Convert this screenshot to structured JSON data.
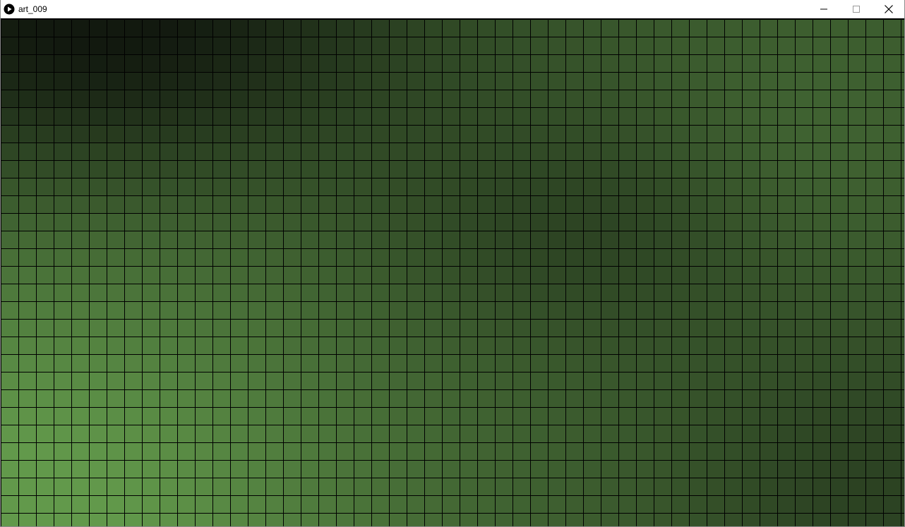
{
  "window": {
    "title": "art_009",
    "app_icon": "play-circle-icon",
    "controls": {
      "minimize_icon": "minimize-icon",
      "maximize_icon": "maximize-icon",
      "close_icon": "close-icon"
    }
  },
  "sketch": {
    "description_colors": {
      "gridline": "#000000",
      "darkest": "#12190f",
      "lightest": "#62994b",
      "mid": "#2e4a25"
    },
    "grid": {
      "columns": 51,
      "rows": 29
    }
  }
}
